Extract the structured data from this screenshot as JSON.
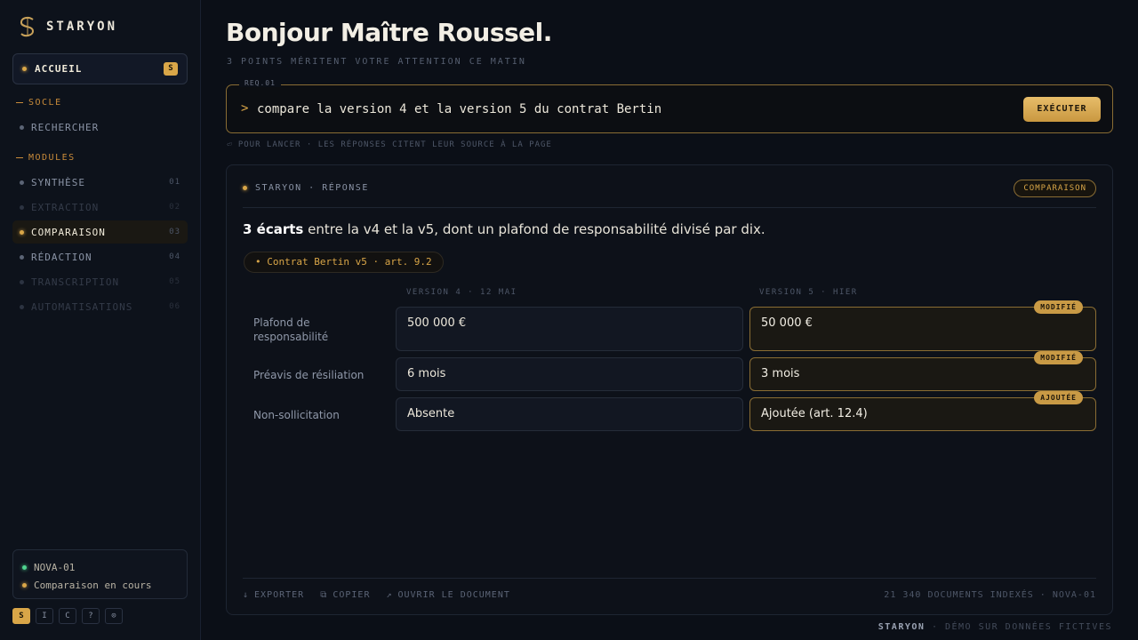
{
  "brand": {
    "name": "STARYON",
    "logo_icon": "staryon-logo-icon"
  },
  "sidebar": {
    "home": {
      "label": "ACCUEIL",
      "badge": "S"
    },
    "sections": [
      {
        "title": "SOCLE",
        "items": [
          {
            "label": "RECHERCHER",
            "num": "",
            "state": "normal"
          }
        ]
      },
      {
        "title": "MODULES",
        "items": [
          {
            "label": "SYNTHÈSE",
            "num": "01",
            "state": "normal"
          },
          {
            "label": "EXTRACTION",
            "num": "02",
            "state": "disabled"
          },
          {
            "label": "COMPARAISON",
            "num": "03",
            "state": "active"
          },
          {
            "label": "RÉDACTION",
            "num": "04",
            "state": "normal"
          },
          {
            "label": "TRANSCRIPTION",
            "num": "05",
            "state": "disabled"
          },
          {
            "label": "AUTOMATISATIONS",
            "num": "06",
            "state": "disabled"
          }
        ]
      }
    ],
    "status": {
      "agent": "NOVA-01",
      "task": "Comparaison en cours"
    },
    "tiny_buttons": [
      "S",
      "I",
      "C",
      "?",
      "⊙"
    ]
  },
  "main": {
    "title": "Bonjour Maître Roussel.",
    "subtitle": "3 POINTS MÉRITENT VOTRE ATTENTION CE MATIN",
    "request": {
      "tag": "REQ.01",
      "prompt": ">",
      "value": "compare la version 4 et la version 5 du contrat Bertin",
      "run_label": "EXÉCUTER"
    },
    "hint": "⏎ POUR LANCER · LES RÉPONSES CITENT LEUR SOURCE À LA PAGE"
  },
  "answer_card": {
    "head": "STARYON · RÉPONSE",
    "mode": "COMPARAISON",
    "summary_bold": "3 écarts",
    "summary_rest": " entre la v4 et la v5, dont un plafond de responsabilité divisé par dix.",
    "source": "• Contrat Bertin v5 · art. 9.2",
    "columns": [
      "VERSION 4 · 12 MAI",
      "VERSION 5 · HIER"
    ],
    "rows": [
      {
        "label": "Plafond de responsabilité",
        "v4": "500 000 €",
        "v5": "50 000 €",
        "flag": "MODIFIÉ"
      },
      {
        "label": "Préavis de résiliation",
        "v4": "6 mois",
        "v5": "3 mois",
        "flag": "MODIFIÉ"
      },
      {
        "label": "Non-sollicitation",
        "v4": "Absente",
        "v5": "Ajoutée (art. 12.4)",
        "flag": "AJOUTÉE"
      }
    ],
    "actions": [
      {
        "icon": "↓",
        "label": "EXPORTER"
      },
      {
        "icon": "⧉",
        "label": "COPIER"
      },
      {
        "icon": "↗",
        "label": "OUVRIR LE DOCUMENT"
      }
    ],
    "meta": "21 340 DOCUMENTS INDEXÉS · NOVA-01"
  },
  "footer": {
    "brand": "STARYON",
    "note": " · DÉMO SUR DONNÉES FICTIVES"
  }
}
